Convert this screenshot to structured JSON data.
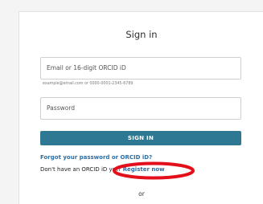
{
  "signin": {
    "title": "Sign in",
    "email_placeholder": "Email or 16-digit ORCID iD",
    "email_hint": "example@email.com or 0000-0001-2345-6789",
    "password_placeholder": "Password",
    "signin_button": "SIGN IN",
    "forgot_link": "Forgot your password or ORCID iD?",
    "no_account_text": "Don't have an ORCID iD yet?",
    "register_link": "Register now",
    "or_text": "or"
  },
  "colors": {
    "accent": "#2e7894",
    "link": "#2e6da4",
    "highlight": "#e3101b"
  }
}
